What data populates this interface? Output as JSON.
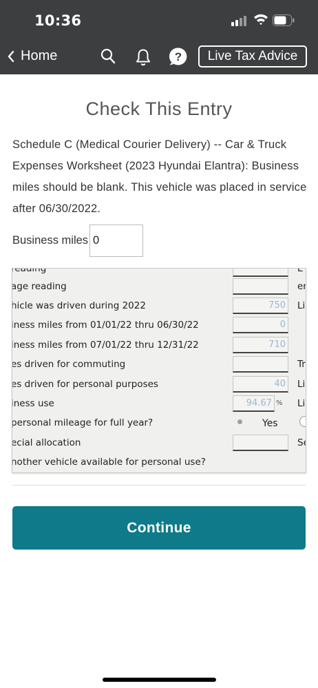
{
  "status": {
    "time": "10:36"
  },
  "nav": {
    "back_label": "Home",
    "live_advice_label": "Live Tax Advice"
  },
  "page": {
    "title": "Check This Entry",
    "message": "Schedule C (Medical Courier Delivery) -- Car & Truck Expenses Worksheet (2023 Hyundai Elantra): Business miles should be blank. This vehicle was placed in service after 06/30/2022.",
    "field_label": "Business miles",
    "field_value": "0"
  },
  "worksheet": {
    "rows": [
      {
        "label": "reading",
        "value": "",
        "right": "E"
      },
      {
        "label": "age reading",
        "value": "",
        "right": "er"
      },
      {
        "label": "hicle was driven during 2022",
        "value": "750",
        "right": "Li"
      },
      {
        "label": "iness miles from 01/01/22 thru 06/30/22",
        "value": "0",
        "right": ""
      },
      {
        "label": "iness miles from 07/01/22 thru 12/31/22",
        "value": "710",
        "right": ""
      },
      {
        "label": "es driven for commuting",
        "value": "",
        "right": "Tr"
      },
      {
        "label": "es driven for personal purposes",
        "value": "40",
        "right": "Li"
      },
      {
        "label": "iness use",
        "value": "94.67",
        "unit": "%",
        "right": "Li"
      },
      {
        "label": "personal mileage for full year?",
        "option": "Yes"
      },
      {
        "label": "ecial allocation",
        "value": "",
        "right": "Se"
      },
      {
        "label": "nother vehicle available for personal use?"
      }
    ]
  },
  "actions": {
    "continue_label": "Continue"
  },
  "colors": {
    "header": "#3d3e40",
    "primary": "#0f7a8a",
    "value_text": "#9ab8d6"
  }
}
